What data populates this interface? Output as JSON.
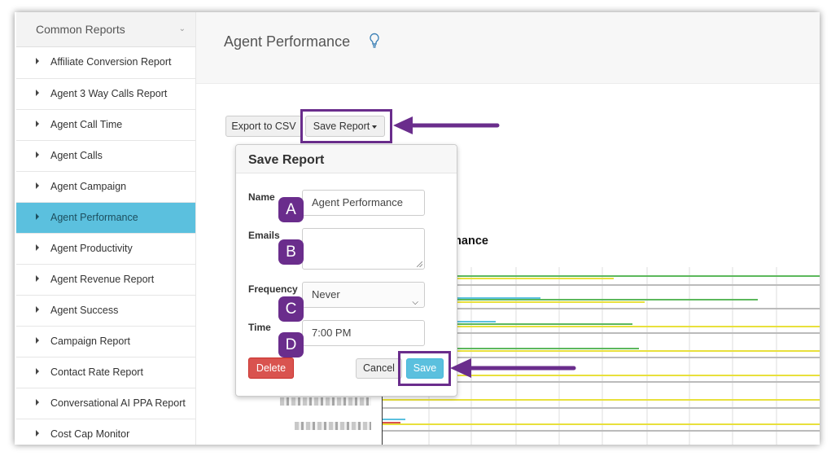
{
  "sidebar": {
    "header": "Common Reports",
    "items": [
      {
        "label": "Affiliate Conversion Report"
      },
      {
        "label": "Agent 3 Way Calls Report"
      },
      {
        "label": "Agent Call Time"
      },
      {
        "label": "Agent Calls"
      },
      {
        "label": "Agent Campaign"
      },
      {
        "label": "Agent Performance",
        "active": true
      },
      {
        "label": "Agent Productivity"
      },
      {
        "label": "Agent Revenue Report"
      },
      {
        "label": "Agent Success"
      },
      {
        "label": "Campaign Report"
      },
      {
        "label": "Contact Rate Report"
      },
      {
        "label": "Conversational AI PPA Report"
      },
      {
        "label": "Cost Cap Monitor"
      }
    ]
  },
  "header": {
    "title": "Agent Performance",
    "icon": "lightbulb-icon"
  },
  "toolbar": {
    "export_label": "Export to CSV",
    "save_report_label": "Save Report"
  },
  "chart": {
    "title_fragment": "mance"
  },
  "save_popover": {
    "title": "Save Report",
    "name_label": "Name",
    "name_value": "Agent Performance",
    "emails_label": "Emails",
    "emails_value": "",
    "frequency_label": "Frequency",
    "frequency_value": "Never",
    "time_label": "Time",
    "time_value": "7:00 PM",
    "delete_label": "Delete",
    "cancel_label": "Cancel",
    "save_label": "Save"
  },
  "callouts": {
    "a": "A",
    "b": "B",
    "c": "C",
    "d": "D"
  },
  "colors": {
    "accent": "#5bc0de",
    "annotation": "#6a2d8c",
    "danger": "#d9534f"
  }
}
